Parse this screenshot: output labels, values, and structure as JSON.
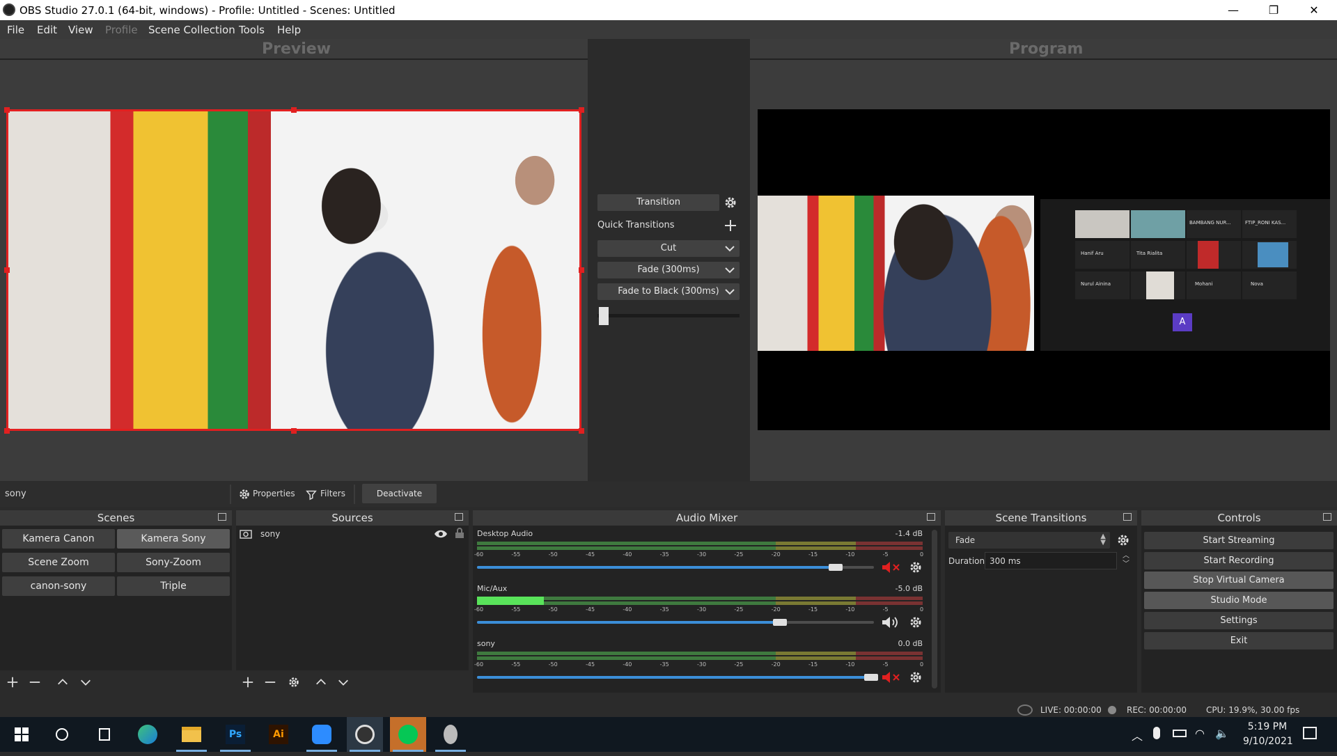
{
  "window": {
    "title": "OBS Studio 27.0.1 (64-bit, windows) - Profile: Untitled - Scenes: Untitled",
    "minimize": "—",
    "maximize": "❐",
    "close": "✕"
  },
  "menu": [
    {
      "label": "File"
    },
    {
      "label": "Edit"
    },
    {
      "label": "View"
    },
    {
      "label": "Profile",
      "disabled": true
    },
    {
      "label": "Scene Collection"
    },
    {
      "label": "Tools"
    },
    {
      "label": "Help"
    }
  ],
  "preview": {
    "title": "Preview"
  },
  "program": {
    "title": "Program"
  },
  "transitions": {
    "transition_label": "Transition",
    "quick_label": "Quick Transitions",
    "items": [
      "Cut",
      "Fade (300ms)",
      "Fade to Black (300ms)"
    ],
    "t_bar_value": 0
  },
  "zoom_call": {
    "participants": [
      {
        "name": "BAMBANG NUR..."
      },
      {
        "name": "FTIP_RONI KAS..."
      },
      {
        "name": "Hanif Aru"
      },
      {
        "name": "Tita Rialita"
      },
      {
        "name": "Nurul Ainina"
      },
      {
        "name": "Mohani"
      },
      {
        "name": "Nova"
      }
    ],
    "avatar_letter": "A"
  },
  "source_bar": {
    "selected_source": "sony",
    "properties": "Properties",
    "filters": "Filters",
    "deactivate": "Deactivate"
  },
  "scenes": {
    "title": "Scenes",
    "items": [
      "Kamera Canon",
      "Kamera Sony",
      "Scene Zoom",
      "Sony-Zoom",
      "canon-sony",
      "Triple"
    ],
    "active": "Kamera Sony"
  },
  "sources": {
    "title": "Sources",
    "items": [
      "sony"
    ]
  },
  "audio_mixer": {
    "title": "Audio Mixer",
    "ticks": [
      "-60",
      "-55",
      "-50",
      "-45",
      "-40",
      "-35",
      "-30",
      "-25",
      "-20",
      "-15",
      "-10",
      "-5",
      "0"
    ],
    "channels": [
      {
        "name": "Desktop Audio",
        "db": "-1.4 dB",
        "volume": 0.91,
        "muted": true,
        "level": 0
      },
      {
        "name": "Mic/Aux",
        "db": "-5.0 dB",
        "volume": 0.77,
        "muted": false,
        "level": 0.15
      },
      {
        "name": "sony",
        "db": "0.0 dB",
        "volume": 1.0,
        "muted": true,
        "level": 0
      }
    ]
  },
  "scene_transitions": {
    "title": "Scene Transitions",
    "selected": "Fade",
    "duration_label": "Duration",
    "duration_value": "300 ms"
  },
  "controls": {
    "title": "Controls",
    "items": [
      "Start Streaming",
      "Start Recording",
      "Stop Virtual Camera",
      "Studio Mode",
      "Settings",
      "Exit"
    ],
    "active": [
      "Stop Virtual Camera",
      "Studio Mode"
    ]
  },
  "status": {
    "live": "LIVE: 00:00:00",
    "rec": "REC: 00:00:00",
    "cpu": "CPU: 19.9%, 30.00 fps"
  },
  "taskbar": {
    "time": "5:19 PM",
    "date": "9/10/2021",
    "apps": [
      "start",
      "search",
      "task-view",
      "edge",
      "file-explorer",
      "photoshop",
      "illustrator",
      "zoom",
      "obs",
      "line",
      "other"
    ]
  },
  "colors": {
    "selection": "#e12020",
    "slider": "#3b8ed8",
    "mute": "#e12020"
  }
}
